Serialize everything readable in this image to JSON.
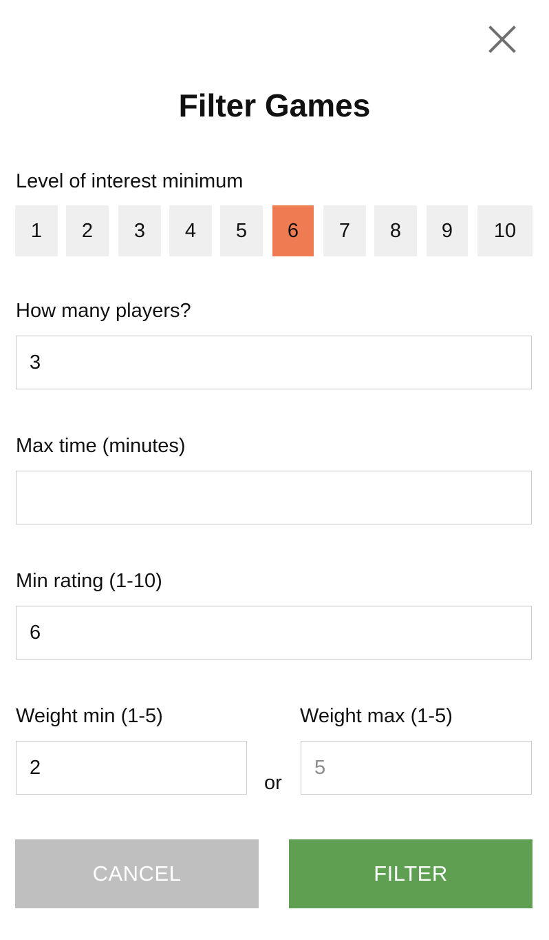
{
  "dialog": {
    "title": "Filter Games",
    "close_icon": "close-icon"
  },
  "interest": {
    "label": "Level of interest minimum",
    "options": [
      "1",
      "2",
      "3",
      "4",
      "5",
      "6",
      "7",
      "8",
      "9",
      "10"
    ],
    "selected": "6",
    "selected_color": "#ee7b52"
  },
  "players": {
    "label": "How many players?",
    "value": "3"
  },
  "max_time": {
    "label": "Max time (minutes)",
    "value": ""
  },
  "min_rating": {
    "label": "Min rating (1-10)",
    "value": "6"
  },
  "weight": {
    "min_label": "Weight min (1-5)",
    "min_value": "2",
    "separator": "or",
    "max_label": "Weight max (1-5)",
    "max_value": "",
    "max_placeholder": "5"
  },
  "actions": {
    "cancel_label": "CANCEL",
    "cancel_color": "#bfbfbf",
    "filter_label": "FILTER",
    "filter_color": "#5e9f52"
  }
}
